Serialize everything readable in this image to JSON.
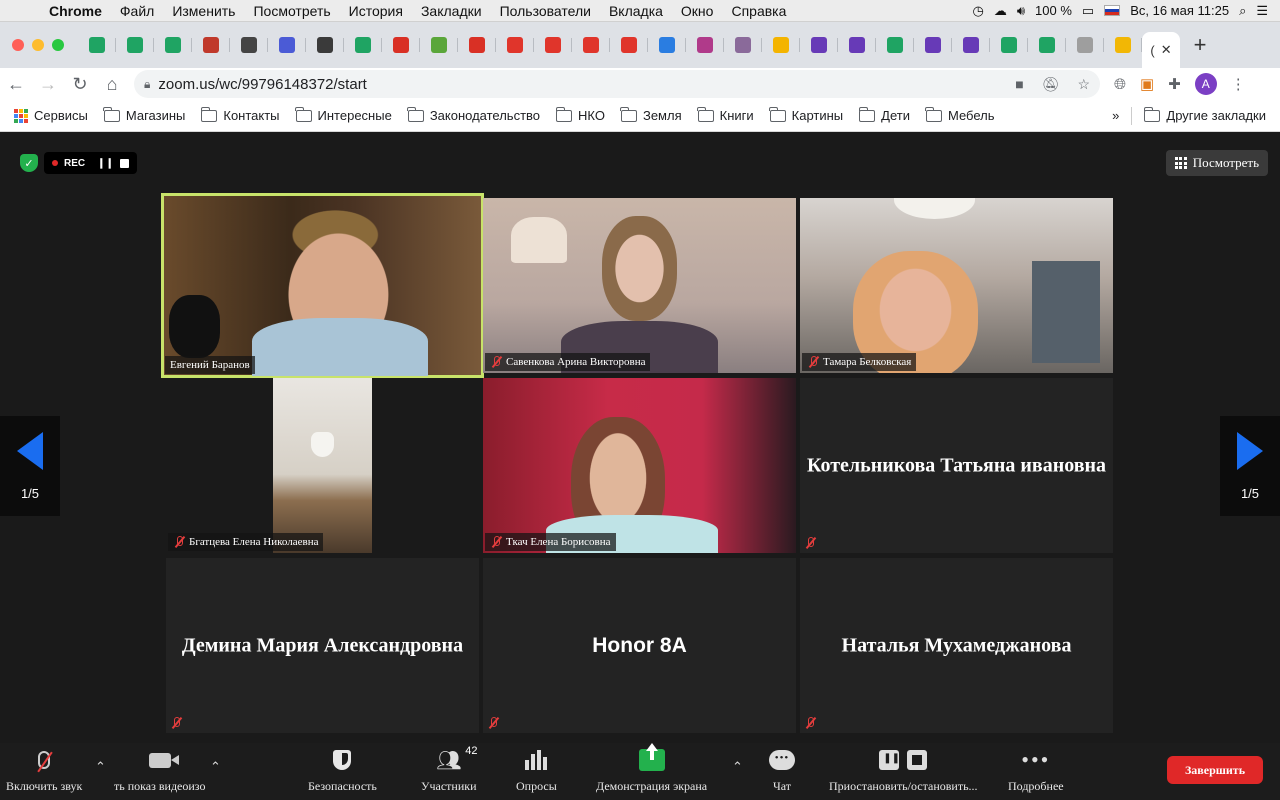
{
  "menubar": {
    "app": "Chrome",
    "items": [
      "Файл",
      "Изменить",
      "Посмотреть",
      "История",
      "Закладки",
      "Пользователи",
      "Вкладка",
      "Окно",
      "Справка"
    ],
    "battery": "100 %",
    "datetime": "Вс, 16 мая  11:25"
  },
  "tabs": {
    "favicons": [
      {
        "icon": "green-plus-icon",
        "color": "#1fa463"
      },
      {
        "icon": "green-plus-icon",
        "color": "#1fa463"
      },
      {
        "icon": "green-plus-icon",
        "color": "#1fa463"
      },
      {
        "icon": "document-icon",
        "color": "#c0392b"
      },
      {
        "icon": "globe-icon",
        "color": "#444444"
      },
      {
        "icon": "picture-icon",
        "color": "#4b5bd6"
      },
      {
        "icon": "painting-icon",
        "color": "#3a3a3a"
      },
      {
        "icon": "green-plus-icon",
        "color": "#1fa463"
      },
      {
        "icon": "red-doc-icon",
        "color": "#d93025"
      },
      {
        "icon": "leaf-icon",
        "color": "#5aa63a"
      },
      {
        "icon": "red-square-icon",
        "color": "#d93025"
      },
      {
        "icon": "red-airplane-icon",
        "color": "#e0352b"
      },
      {
        "icon": "red-airplane-icon",
        "color": "#e0352b"
      },
      {
        "icon": "red-airplane-icon",
        "color": "#e0352b"
      },
      {
        "icon": "red-airplane-icon",
        "color": "#e0352b"
      },
      {
        "icon": "u-icon",
        "color": "#2a7de1"
      },
      {
        "icon": "museum-icon",
        "color": "#b03a8a"
      },
      {
        "icon": "coin-icon",
        "color": "#8a6a9a"
      },
      {
        "icon": "drive-icon",
        "color": "#f4b400"
      },
      {
        "icon": "form-icon",
        "color": "#673ab7"
      },
      {
        "icon": "form-icon",
        "color": "#673ab7"
      },
      {
        "icon": "green-plus-icon",
        "color": "#1fa463"
      },
      {
        "icon": "form-icon",
        "color": "#673ab7"
      },
      {
        "icon": "form-icon",
        "color": "#673ab7"
      },
      {
        "icon": "green-plus-icon",
        "color": "#1fa463"
      },
      {
        "icon": "green-plus-icon",
        "color": "#1fa463"
      },
      {
        "icon": "yandex-icon",
        "color": "#9e9e9e"
      },
      {
        "icon": "image-icon",
        "color": "#f2b705"
      }
    ],
    "active_label": "(",
    "new_tab": "+"
  },
  "nav": {
    "url": "zoom.us/wc/99796148372/start",
    "avatar_letter": "A"
  },
  "bookmarks": {
    "apps": "Сервисы",
    "folders": [
      "Магазины",
      "Контакты",
      "Интересные",
      "Законодательство",
      "НКО",
      "Земля",
      "Книги",
      "Картины",
      "Дети",
      "Мебель"
    ],
    "more": "»",
    "other": "Другие закладки"
  },
  "zoom": {
    "rec_label": "REC",
    "view_label": "Посмотреть",
    "page_indicator": "1/5",
    "accent_color": "#1a6df0",
    "speaker_color": "#c8e36a",
    "participants": [
      {
        "name": "Евгений Баранов",
        "muted": false,
        "video": true
      },
      {
        "name": "Савенкова Арина Викторовна",
        "muted": true,
        "video": true
      },
      {
        "name": "Тамара Белковская",
        "muted": true,
        "video": true
      },
      {
        "name": "Бгатцева Елена Николаевна",
        "muted": true,
        "video": true
      },
      {
        "name": "Ткач Елена Борисовна",
        "muted": true,
        "video": true
      },
      {
        "name": "Котельникова Татьяна ивановна",
        "muted": true,
        "video": false
      },
      {
        "name": "Демина Мария Александровна",
        "muted": true,
        "video": false
      },
      {
        "name": "Honor 8A",
        "muted": true,
        "video": false
      },
      {
        "name": "Наталья Мухамеджанова",
        "muted": true,
        "video": false
      }
    ]
  },
  "toolbar": {
    "unmute": "Включить звук",
    "video": "ть показ видеоизо",
    "security": "Безопасность",
    "participants": "Участники",
    "participants_count": "42",
    "polls": "Опросы",
    "share": "Демонстрация экрана",
    "chat": "Чат",
    "record": "Приостановить/остановить...",
    "more": "Подробнее",
    "end": "Завершить"
  }
}
